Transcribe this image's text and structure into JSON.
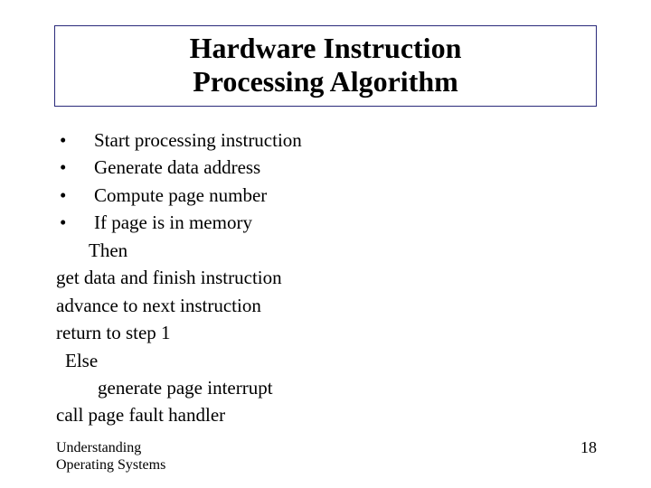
{
  "title": {
    "line1": "Hardware Instruction",
    "line2": "Processing Algorithm"
  },
  "bullets": [
    "Start processing instruction",
    "Generate data address",
    "Compute page number",
    "If page is in memory"
  ],
  "lines": {
    "then": "Then",
    "get_data": "get data and finish instruction",
    "advance": "advance to next instruction",
    "return": "return to step 1",
    "else": "Else",
    "gen_int": "generate page interrupt",
    "call_handler": "call page fault handler"
  },
  "footer": {
    "left_line1": "Understanding",
    "left_line2": "Operating Systems",
    "page_number": "18"
  }
}
